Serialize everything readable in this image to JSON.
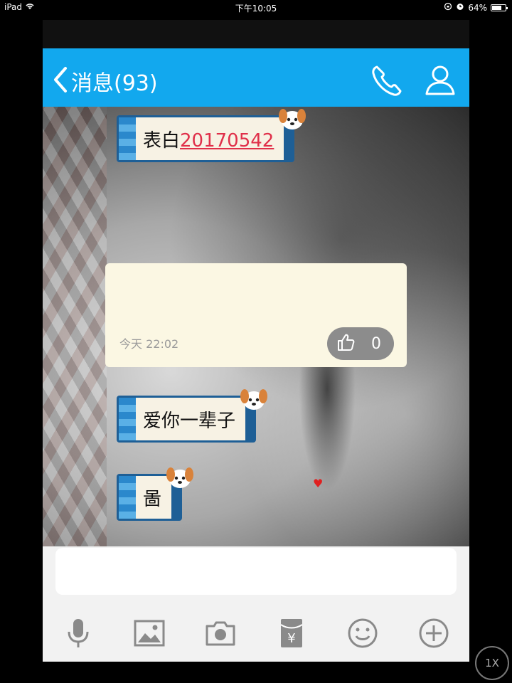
{
  "status_bar": {
    "device": "iPad",
    "time": "下午10:05",
    "battery": "64%"
  },
  "nav": {
    "back_label": "消息(93)",
    "icons": {
      "back": "chevron-left-icon",
      "call": "phone-icon",
      "profile": "user-icon"
    },
    "color": "#12a8ee"
  },
  "messages": [
    {
      "text_prefix": "表白",
      "text_link": "20170542"
    },
    {
      "text": "爱你一辈子"
    },
    {
      "text": "啚"
    }
  ],
  "card": {
    "time": "今天 22:02",
    "like_count": "0"
  },
  "input": {
    "placeholder": ""
  },
  "toolbar": {
    "icons": [
      "microphone-icon",
      "image-icon",
      "camera-icon",
      "red-packet-icon",
      "emoji-icon",
      "plus-icon"
    ]
  },
  "zoom_button": {
    "label": "1X"
  }
}
